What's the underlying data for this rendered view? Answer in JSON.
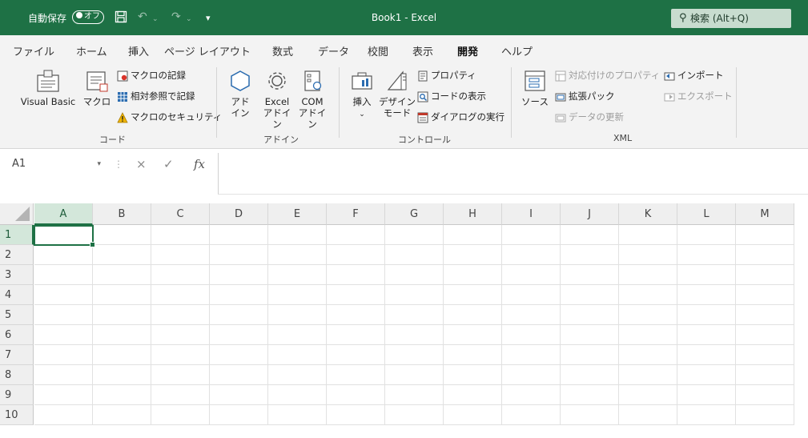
{
  "titlebar": {
    "autosave_label": "自動保存",
    "autosave_state": "オフ",
    "save_icon": "save-icon",
    "undo_icon": "undo-icon",
    "redo_icon": "redo-icon",
    "customize_icon": "customize-qat-icon",
    "title": "Book1  -  Excel",
    "search_placeholder": "検索 (Alt+Q)",
    "bg_color": "#1e7145"
  },
  "tabs": [
    {
      "label": "ファイル",
      "active": false
    },
    {
      "label": "ホーム",
      "active": false
    },
    {
      "label": "挿入",
      "active": false
    },
    {
      "label": "ページ レイアウト",
      "active": false
    },
    {
      "label": "数式",
      "active": false
    },
    {
      "label": "データ",
      "active": false
    },
    {
      "label": "校閲",
      "active": false
    },
    {
      "label": "表示",
      "active": false
    },
    {
      "label": "開発",
      "active": true
    },
    {
      "label": "ヘルプ",
      "active": false
    }
  ],
  "ribbon": {
    "code": {
      "label": "コード",
      "visual_basic": "Visual Basic",
      "macro": "マクロ",
      "record_macro": "マクロの記録",
      "relative_ref": "相対参照で記録",
      "macro_security": "マクロのセキュリティ"
    },
    "addins": {
      "label": "アドイン",
      "addin_line1": "アド",
      "addin_line2": "イン",
      "excel_line1": "Excel",
      "excel_line2": "アドイン",
      "com_line1": "COM",
      "com_line2": "アドイン"
    },
    "controls": {
      "label": "コントロール",
      "insert": "挿入",
      "design_line1": "デザイン",
      "design_line2": "モード",
      "properties": "プロパティ",
      "view_code": "コードの表示",
      "run_dialog": "ダイアログの実行"
    },
    "xml": {
      "label": "XML",
      "source": "ソース",
      "map_properties": "対応付けのプロパティ",
      "expansion_packs": "拡張パック",
      "refresh_data": "データの更新",
      "import": "インポート",
      "export": "エクスポート"
    }
  },
  "formula_bar": {
    "name_box": "A1",
    "cancel_icon": "×",
    "enter_icon": "✓",
    "fx_icon": "fx",
    "value": ""
  },
  "grid": {
    "columns": [
      "A",
      "B",
      "C",
      "D",
      "E",
      "F",
      "G",
      "H",
      "I",
      "J",
      "K",
      "L",
      "M"
    ],
    "rows": [
      "1",
      "2",
      "3",
      "4",
      "5",
      "6",
      "7",
      "8",
      "9",
      "10"
    ],
    "active_cell": "A1",
    "accent_color": "#1e7145"
  }
}
